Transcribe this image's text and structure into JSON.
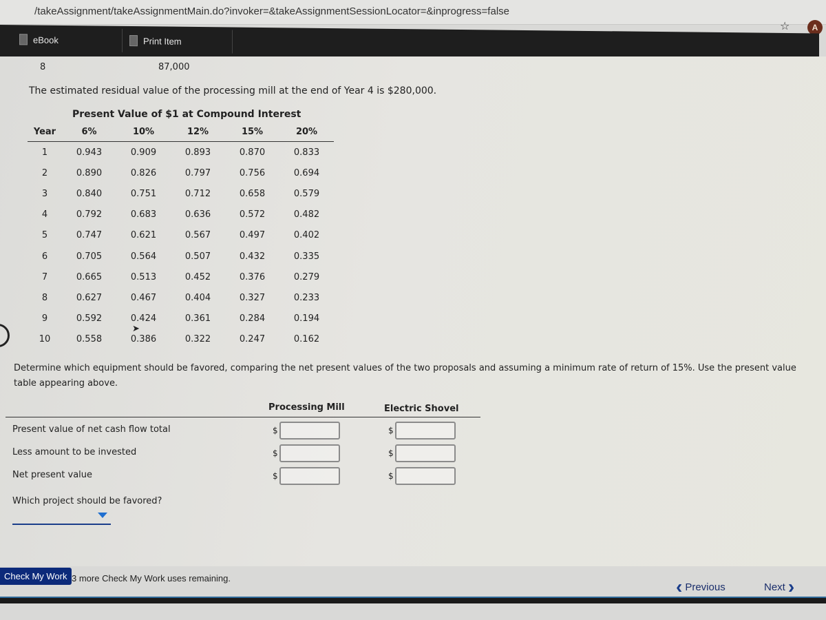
{
  "browser": {
    "url": "/takeAssignment/takeAssignmentMain.do?invoker=&takeAssignmentSessionLocator=&inprogress=false",
    "avatar_letter": "A"
  },
  "toolbar": {
    "ebook_label": "eBook",
    "print_label": "Print Item"
  },
  "cash_flow_row": {
    "year": "8",
    "value": "87,000"
  },
  "intro_text": "The estimated residual value of the processing mill at the end of Year 4 is $280,000.",
  "pv_table": {
    "title": "Present Value of $1 at Compound Interest",
    "headers": [
      "Year",
      "6%",
      "10%",
      "12%",
      "15%",
      "20%"
    ],
    "rows": [
      [
        "1",
        "0.943",
        "0.909",
        "0.893",
        "0.870",
        "0.833"
      ],
      [
        "2",
        "0.890",
        "0.826",
        "0.797",
        "0.756",
        "0.694"
      ],
      [
        "3",
        "0.840",
        "0.751",
        "0.712",
        "0.658",
        "0.579"
      ],
      [
        "4",
        "0.792",
        "0.683",
        "0.636",
        "0.572",
        "0.482"
      ],
      [
        "5",
        "0.747",
        "0.621",
        "0.567",
        "0.497",
        "0.402"
      ],
      [
        "6",
        "0.705",
        "0.564",
        "0.507",
        "0.432",
        "0.335"
      ],
      [
        "7",
        "0.665",
        "0.513",
        "0.452",
        "0.376",
        "0.279"
      ],
      [
        "8",
        "0.627",
        "0.467",
        "0.404",
        "0.327",
        "0.233"
      ],
      [
        "9",
        "0.592",
        "0.424",
        "0.361",
        "0.284",
        "0.194"
      ],
      [
        "10",
        "0.558",
        "0.386",
        "0.322",
        "0.247",
        "0.162"
      ]
    ]
  },
  "instructions": "Determine which equipment should be favored, comparing the net present values of the two proposals and assuming a minimum rate of return of 15%. Use the present value table appearing above.",
  "answer": {
    "col_headers": [
      "Processing Mill",
      "Electric Shovel"
    ],
    "currency_symbol": "$",
    "rows": [
      {
        "label": "Present value of net cash flow total",
        "processing_mill": "",
        "electric_shovel": ""
      },
      {
        "label": "Less amount to be invested",
        "processing_mill": "",
        "electric_shovel": ""
      },
      {
        "label": "Net present value",
        "processing_mill": "",
        "electric_shovel": ""
      }
    ],
    "favored_question": "Which project should be favored?",
    "favored_value": ""
  },
  "footer": {
    "check_label": "Check My Work",
    "remaining_text": "3 more Check My Work uses remaining.",
    "previous_label": "Previous",
    "next_label": "Next"
  },
  "colors": {
    "check_button": "#0c2a7a",
    "nav_link": "#1a2e6b",
    "dropdown_caret": "#1f6fd0"
  }
}
